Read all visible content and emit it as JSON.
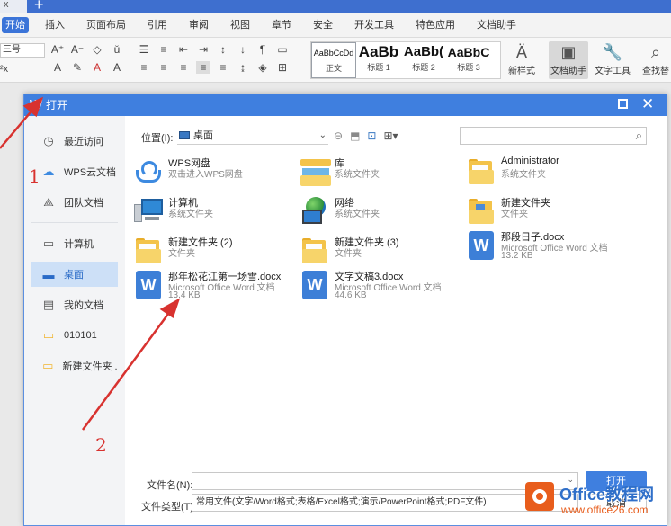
{
  "app": {
    "menu": [
      "开始",
      "插入",
      "页面布局",
      "引用",
      "审阅",
      "视图",
      "章节",
      "安全",
      "开发工具",
      "特色应用",
      "文档助手"
    ],
    "font_box": "三号",
    "font_size": "²x",
    "styles": [
      {
        "sample": "AaBbCcDd",
        "name": "正文"
      },
      {
        "sample": "AaBb",
        "name": "标题 1"
      },
      {
        "sample": "AaBb(",
        "name": "标题 2"
      },
      {
        "sample": "AaBbC",
        "name": "标题 3"
      }
    ],
    "ribbon_right": [
      {
        "label": "新样式",
        "icon": "A"
      },
      {
        "label": "文档助手",
        "icon": "▢"
      },
      {
        "label": "文字工具",
        "icon": "✎"
      },
      {
        "label": "查找替",
        "icon": "⌕"
      }
    ]
  },
  "dialog": {
    "title": "打开",
    "sidebar": [
      {
        "label": "最近访问",
        "icon": "clock-icon"
      },
      {
        "label": "WPS云文档",
        "icon": "cloud-icon"
      },
      {
        "label": "团队文档",
        "icon": "team-icon"
      },
      {
        "label": "计算机",
        "icon": "computer-icon"
      },
      {
        "label": "桌面",
        "icon": "desktop-icon"
      },
      {
        "label": "我的文档",
        "icon": "documents-icon"
      },
      {
        "label": "010101",
        "icon": "folder-icon"
      },
      {
        "label": "新建文件夹 ...",
        "icon": "folder-icon"
      }
    ],
    "location_label": "位置(I):",
    "location_value": "桌面",
    "files": [
      {
        "name": "WPS网盘",
        "sub": "双击进入WPS网盘",
        "size": "",
        "type": "cloud"
      },
      {
        "name": "库",
        "sub": "系统文件夹",
        "size": "",
        "type": "library"
      },
      {
        "name": "Administrator",
        "sub": "系统文件夹",
        "size": "",
        "type": "folder"
      },
      {
        "name": "计算机",
        "sub": "系统文件夹",
        "size": "",
        "type": "computer"
      },
      {
        "name": "网络",
        "sub": "系统文件夹",
        "size": "",
        "type": "network"
      },
      {
        "name": "新建文件夹",
        "sub": "文件夹",
        "size": "",
        "type": "folder-blue"
      },
      {
        "name": "新建文件夹 (2)",
        "sub": "文件夹",
        "size": "",
        "type": "folder"
      },
      {
        "name": "新建文件夹 (3)",
        "sub": "文件夹",
        "size": "",
        "type": "folder"
      },
      {
        "name": "那段日子.docx",
        "sub": "Microsoft Office Word 文档",
        "size": "13.2 KB",
        "type": "word"
      },
      {
        "name": "那年松花江第一场雪.docx",
        "sub": "Microsoft Office Word 文档",
        "size": "13.4 KB",
        "type": "word"
      },
      {
        "name": "文字文稿3.docx",
        "sub": "Microsoft Office Word 文档",
        "size": "44.6 KB",
        "type": "word"
      }
    ],
    "filename_label": "文件名(N):",
    "filename_value": "",
    "filetype_label": "文件类型(T):",
    "filetype_value": "常用文件(文字/Word格式;表格/Excel格式;演示/PowerPoint格式;PDF文件)",
    "open_button": "打开",
    "cancel_button": "取消"
  },
  "annotations": [
    "1",
    "2"
  ],
  "watermark": {
    "main": "Office教程网",
    "sub": "www.office26.com"
  }
}
